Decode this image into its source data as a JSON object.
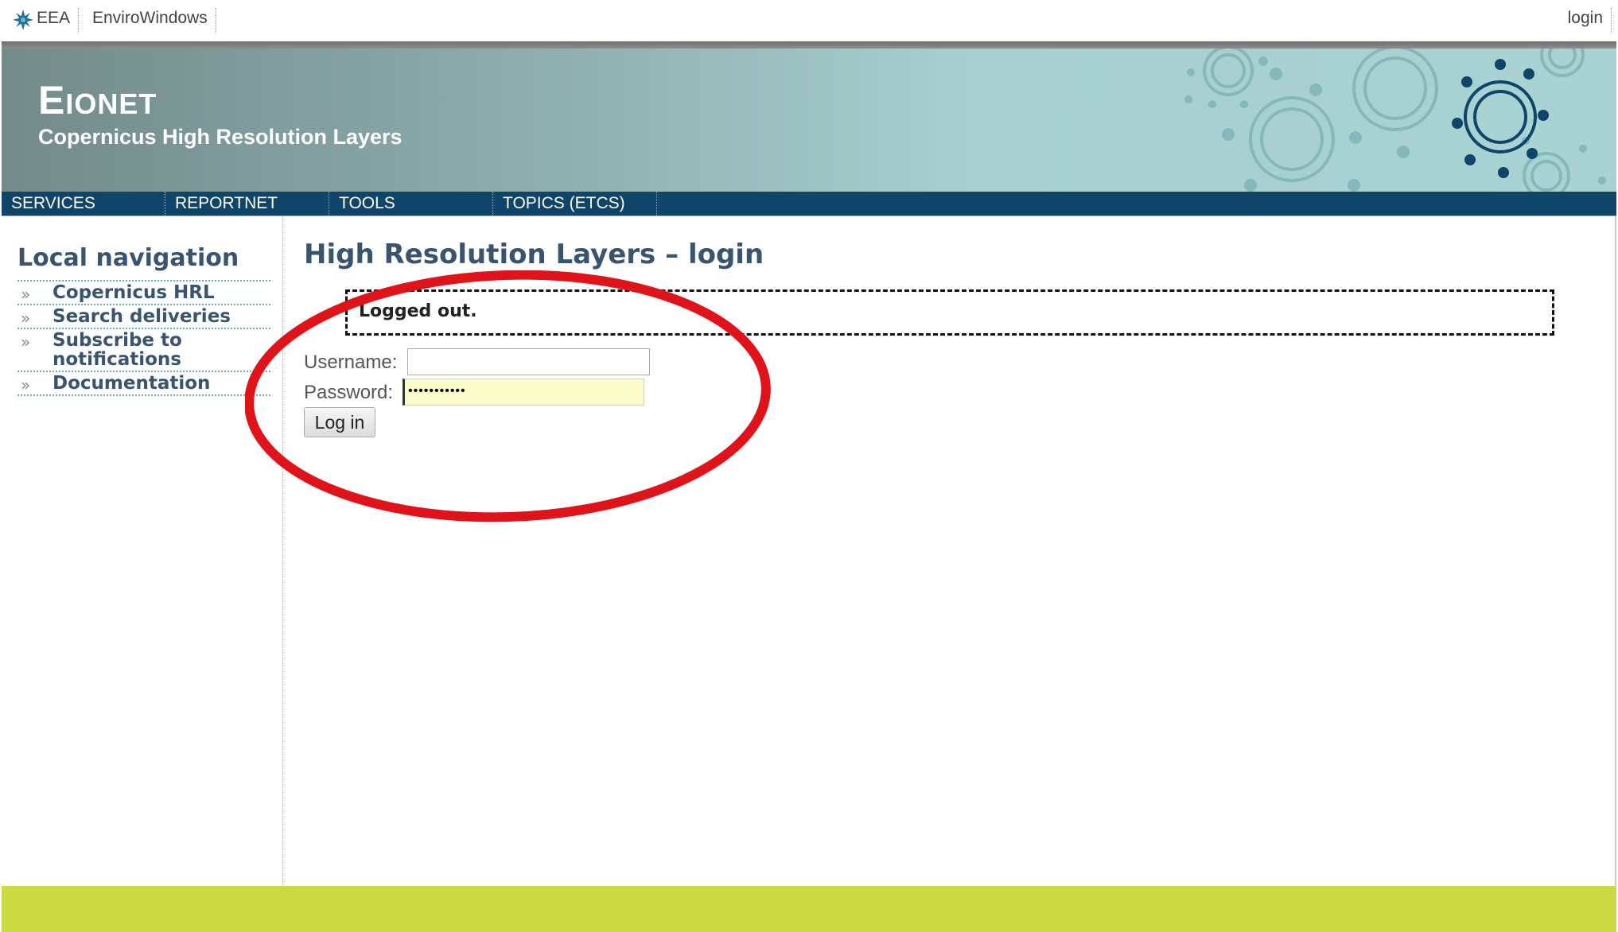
{
  "topbar": {
    "links": [
      "EEA",
      "EnviroWindows"
    ],
    "login": "login"
  },
  "header": {
    "brand_first": "E",
    "brand_rest": "IONET",
    "subtitle": "Copernicus High Resolution Layers"
  },
  "navbar": {
    "items": [
      "SERVICES",
      "REPORTNET",
      "TOOLS",
      "TOPICS (ETCS)"
    ]
  },
  "sidebar": {
    "title": "Local navigation",
    "items": [
      {
        "label": "Copernicus HRL"
      },
      {
        "label": "Search deliveries"
      },
      {
        "label": "Subscribe to notifications"
      },
      {
        "label": "Documentation"
      }
    ]
  },
  "main": {
    "title": "High Resolution Layers – login",
    "message": "Logged out.",
    "username_label": "Username:",
    "password_label": "Password:",
    "username_value": "",
    "password_mask": "•••••••••••",
    "login_button": "Log in"
  },
  "colors": {
    "nav_bg": "#0e4568",
    "footer": "#cbd942",
    "annotation": "#e0131a"
  }
}
